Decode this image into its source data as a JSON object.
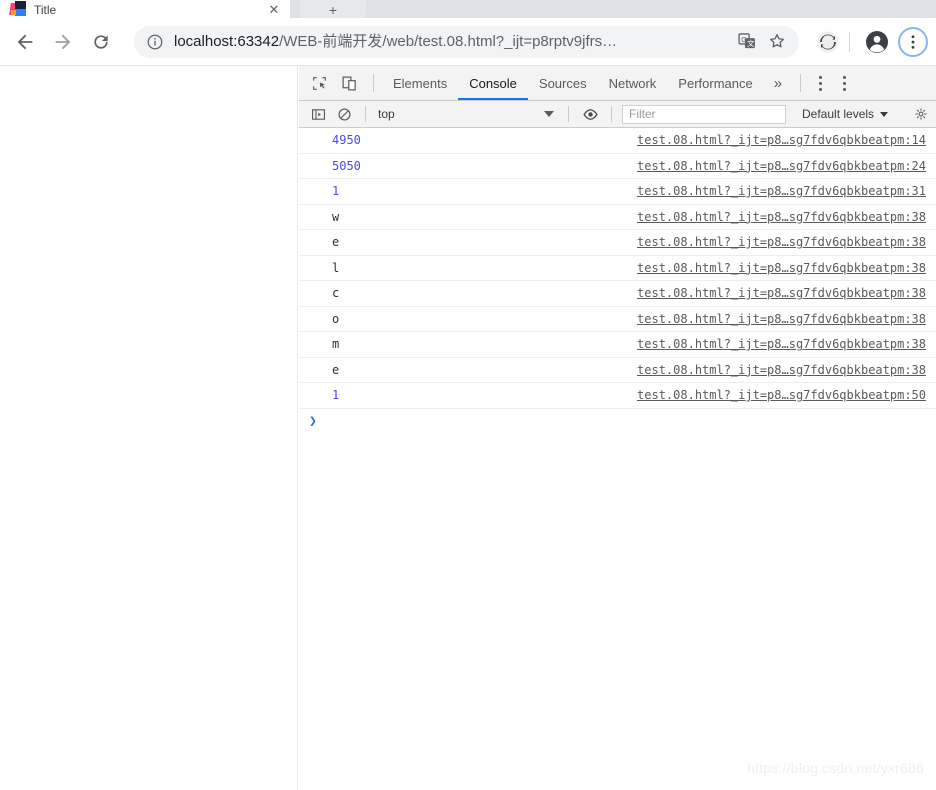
{
  "browser": {
    "tab": {
      "title": "Title",
      "close_label": "✕",
      "favicon": "webstorm-icon"
    },
    "new_tab_label": "+",
    "nav": {
      "back": "back-arrow-icon",
      "forward": "forward-arrow-icon",
      "reload": "reload-icon"
    },
    "omnibox": {
      "info_icon": "site-info-icon",
      "url_host": "localhost:63342",
      "url_path": "/WEB-前端开发/web/test.08.html?_ijt=p8rptv9jfrs…",
      "translate_icon": "translate-icon",
      "star_icon": "bookmark-star-icon"
    },
    "toolbar_icons": {
      "sync": "sync-extension-icon",
      "profile": "profile-avatar-icon",
      "menu": "three-dot-menu-icon"
    }
  },
  "devtools": {
    "inspect_icon": "inspect-element-icon",
    "device_icon": "device-toolbar-icon",
    "tabs": [
      {
        "label": "Elements",
        "active": false
      },
      {
        "label": "Console",
        "active": true
      },
      {
        "label": "Sources",
        "active": false
      },
      {
        "label": "Network",
        "active": false
      },
      {
        "label": "Performance",
        "active": false
      }
    ],
    "more_tabs_label": "»",
    "menu_icon": "devtools-menu-icon",
    "filterbar": {
      "sidebar_icon": "console-sidebar-icon",
      "clear_icon": "clear-console-icon",
      "context": "top",
      "eye_icon": "live-expression-eye-icon",
      "filter_placeholder": "Filter",
      "levels_label": "Default levels",
      "settings_icon": "settings-gear-icon"
    },
    "console_logs": [
      {
        "message": "4950",
        "type": "number",
        "source": "test.08.html?_ijt=p8…sg7fdv6qbkbeatpm:14"
      },
      {
        "message": "5050",
        "type": "number",
        "source": "test.08.html?_ijt=p8…sg7fdv6qbkbeatpm:24"
      },
      {
        "message": "1",
        "type": "number",
        "source": "test.08.html?_ijt=p8…sg7fdv6qbkbeatpm:31"
      },
      {
        "message": "w",
        "type": "string",
        "source": "test.08.html?_ijt=p8…sg7fdv6qbkbeatpm:38"
      },
      {
        "message": "e",
        "type": "string",
        "source": "test.08.html?_ijt=p8…sg7fdv6qbkbeatpm:38"
      },
      {
        "message": "l",
        "type": "string",
        "source": "test.08.html?_ijt=p8…sg7fdv6qbkbeatpm:38"
      },
      {
        "message": "c",
        "type": "string",
        "source": "test.08.html?_ijt=p8…sg7fdv6qbkbeatpm:38"
      },
      {
        "message": "o",
        "type": "string",
        "source": "test.08.html?_ijt=p8…sg7fdv6qbkbeatpm:38"
      },
      {
        "message": "m",
        "type": "string",
        "source": "test.08.html?_ijt=p8…sg7fdv6qbkbeatpm:38"
      },
      {
        "message": "e",
        "type": "string",
        "source": "test.08.html?_ijt=p8…sg7fdv6qbkbeatpm:38"
      },
      {
        "message": "1",
        "type": "number",
        "source": "test.08.html?_ijt=p8…sg7fdv6qbkbeatpm:50"
      }
    ],
    "prompt": "❯"
  },
  "watermark": "https://blog.csdn.net/yxr686",
  "colors": {
    "accent": "#1a73e8",
    "number": "#4a4ae8",
    "chrome_bg": "#dee1e6",
    "devtools_bg": "#f3f3f3"
  }
}
